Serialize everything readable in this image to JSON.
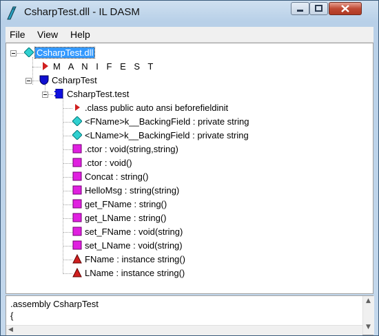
{
  "window": {
    "title": "CsharpTest.dll - IL DASM"
  },
  "menu": {
    "items": [
      "File",
      "View",
      "Help"
    ]
  },
  "tree": {
    "root": "CsharpTest.dll",
    "manifest": "M A N I F E S T",
    "namespace": "CsharpTest",
    "class_name": "CsharpTest.test",
    "members": [
      {
        "label": ".class public auto ansi beforefieldinit",
        "icon": "class-info-icon"
      },
      {
        "label": "<FName>k__BackingField : private string",
        "icon": "field-icon"
      },
      {
        "label": "<LName>k__BackingField : private string",
        "icon": "field-icon"
      },
      {
        "label": ".ctor : void(string,string)",
        "icon": "method-icon"
      },
      {
        "label": ".ctor : void()",
        "icon": "method-icon"
      },
      {
        "label": "Concat : string()",
        "icon": "method-icon"
      },
      {
        "label": "HelloMsg : string(string)",
        "icon": "method-icon"
      },
      {
        "label": "get_FName : string()",
        "icon": "method-icon"
      },
      {
        "label": "get_LName : string()",
        "icon": "method-icon"
      },
      {
        "label": "set_FName : void(string)",
        "icon": "method-icon"
      },
      {
        "label": "set_LName : void(string)",
        "icon": "method-icon"
      },
      {
        "label": "FName : instance string()",
        "icon": "property-icon"
      },
      {
        "label": "LName : instance string()",
        "icon": "property-icon"
      }
    ]
  },
  "info_pane": {
    "lines": [
      ".assembly CsharpTest",
      "{"
    ]
  },
  "colors": {
    "selection": "#3399ff",
    "method": "#e020e0",
    "field": "#30d0d0",
    "property": "#d02020",
    "namespace": "#1010d0"
  }
}
